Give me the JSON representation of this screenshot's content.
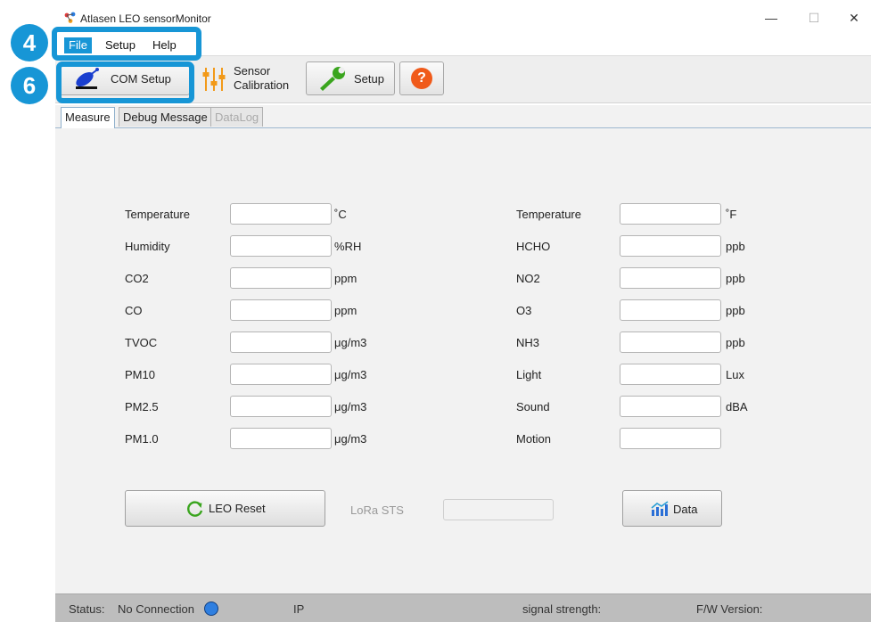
{
  "window": {
    "title": "Atlasen LEO sensorMonitor",
    "controls": {
      "minimize": "—",
      "maximize": "☐",
      "close": "✕"
    }
  },
  "menu": {
    "file": "File",
    "setup": "Setup",
    "help": "Help"
  },
  "toolbar": {
    "com_setup": "COM Setup",
    "sensor_line1": "Sensor",
    "sensor_line2": "Calibration",
    "setup": "Setup",
    "help": "?"
  },
  "tabs": {
    "measure": "Measure",
    "debug": "Debug Message",
    "datalog": "DataLog"
  },
  "measure": {
    "left": [
      {
        "label": "Temperature",
        "unit": "˚C"
      },
      {
        "label": "Humidity",
        "unit": "%RH"
      },
      {
        "label": "CO2",
        "unit": "ppm"
      },
      {
        "label": "CO",
        "unit": "ppm"
      },
      {
        "label": "TVOC",
        "unit": "μg/m3"
      },
      {
        "label": "PM10",
        "unit": "μg/m3"
      },
      {
        "label": "PM2.5",
        "unit": "μg/m3"
      },
      {
        "label": "PM1.0",
        "unit": "μg/m3"
      }
    ],
    "right": [
      {
        "label": "Temperature",
        "unit": "˚F"
      },
      {
        "label": "HCHO",
        "unit": "ppb"
      },
      {
        "label": "NO2",
        "unit": "ppb"
      },
      {
        "label": "O3",
        "unit": "ppb"
      },
      {
        "label": "NH3",
        "unit": "ppb"
      },
      {
        "label": "Light",
        "unit": "Lux"
      },
      {
        "label": "Sound",
        "unit": "dBA"
      },
      {
        "label": "Motion",
        "unit": ""
      }
    ],
    "leo_reset": "LEO Reset",
    "lora_sts": "LoRa STS",
    "data": "Data"
  },
  "status": {
    "status_label": "Status:",
    "connection": "No Connection",
    "ip": "IP",
    "signal": "signal strength:",
    "fw": "F/W Version:"
  },
  "annotations": {
    "menu_number": "4",
    "toolbar_number": "6"
  },
  "colors": {
    "annotation": "#1796d6",
    "status_dot": "#2f7fe0",
    "help_button": "#f05a1a",
    "tab_border": "#8fb0cc"
  }
}
